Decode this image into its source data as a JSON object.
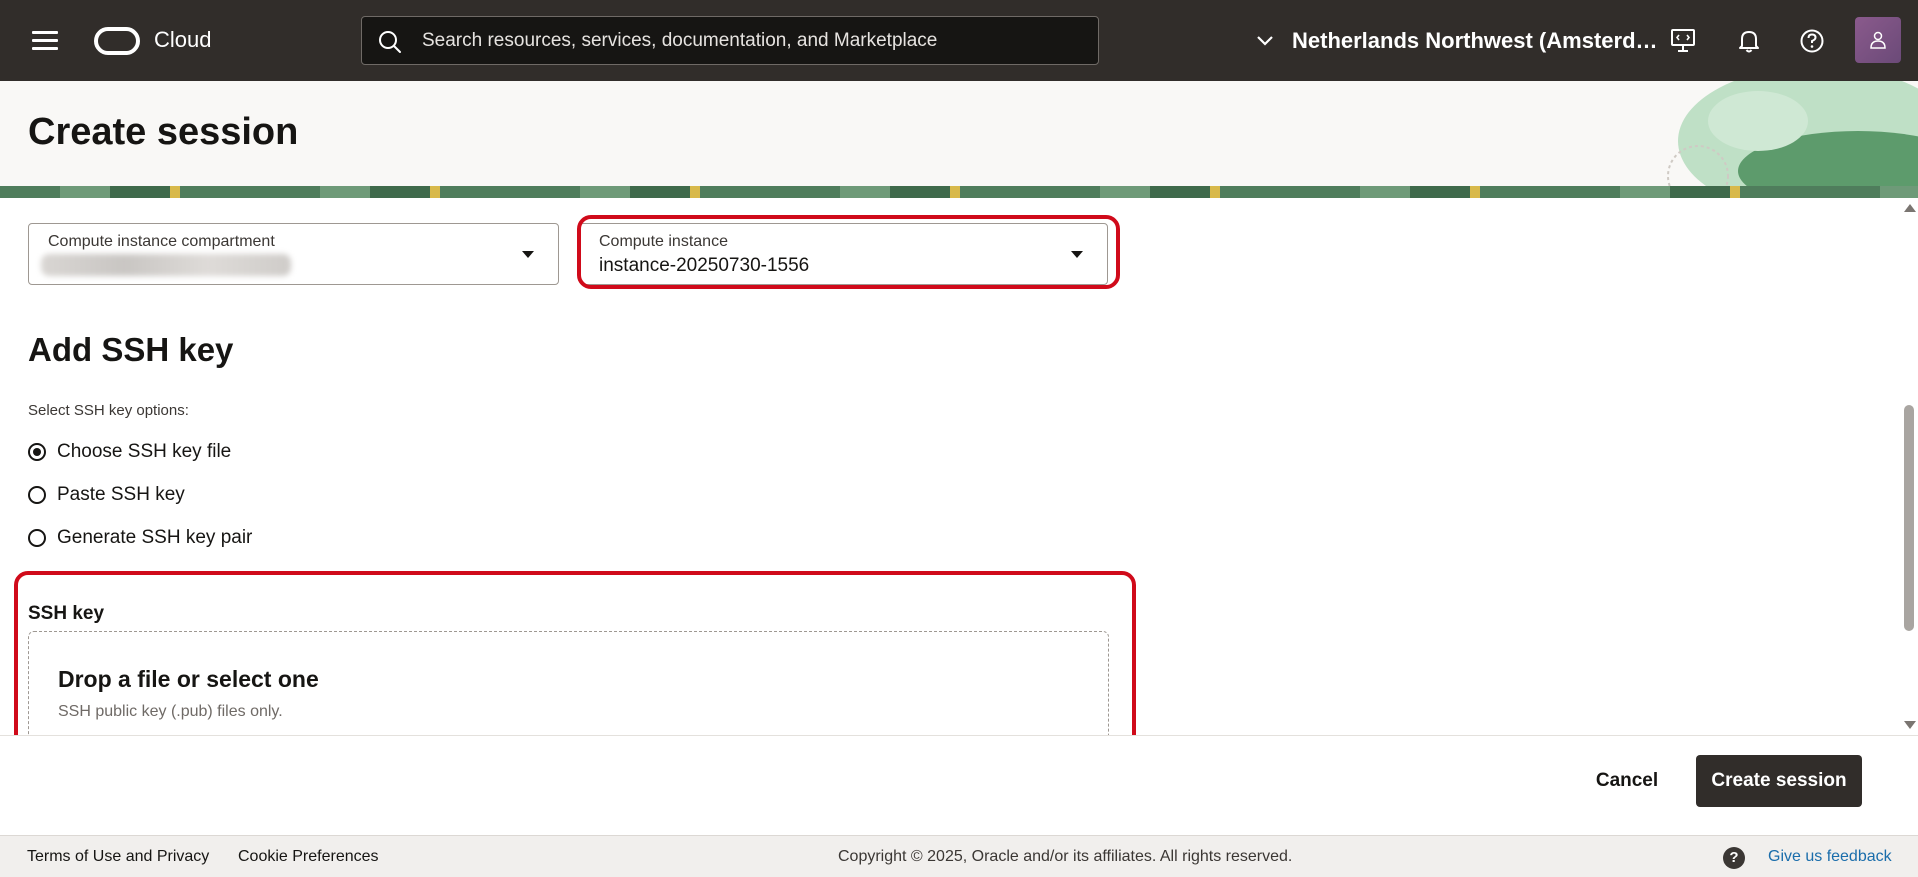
{
  "topbar": {
    "menu_icon": "hamburger-menu-icon",
    "brand": "Cloud",
    "search_placeholder": "Search resources, services, documentation, and Marketplace",
    "region": "Netherlands Northwest (Amsterdam)",
    "icons": [
      "cloud-shell-icon",
      "bell-icon",
      "help-icon",
      "user-icon"
    ]
  },
  "page": {
    "title": "Create session"
  },
  "form": {
    "compartment": {
      "label": "Compute instance compartment",
      "value": ""
    },
    "instance": {
      "label": "Compute instance",
      "value": "instance-20250730-1556"
    },
    "ssh_section_title": "Add SSH key",
    "options_label": "Select SSH key options:",
    "options": [
      {
        "label": "Choose SSH key file",
        "selected": true
      },
      {
        "label": "Paste SSH key",
        "selected": false
      },
      {
        "label": "Generate SSH key pair",
        "selected": false
      }
    ],
    "ssh_key_label": "SSH key",
    "dropzone": {
      "title": "Drop a file or select one",
      "subtitle": "SSH public key (.pub) files only."
    }
  },
  "actions": {
    "cancel": "Cancel",
    "create": "Create session"
  },
  "footer": {
    "terms": "Terms of Use and Privacy",
    "cookies": "Cookie Preferences",
    "copyright": "Copyright © 2025, Oracle and/or its affiliates. All rights reserved.",
    "help_glyph": "?",
    "feedback": "Give us feedback"
  },
  "colors": {
    "topbar_bg": "#312d2a",
    "highlight": "#d00a1a",
    "primary_button": "#312d2a",
    "link": "#1a6dab"
  }
}
